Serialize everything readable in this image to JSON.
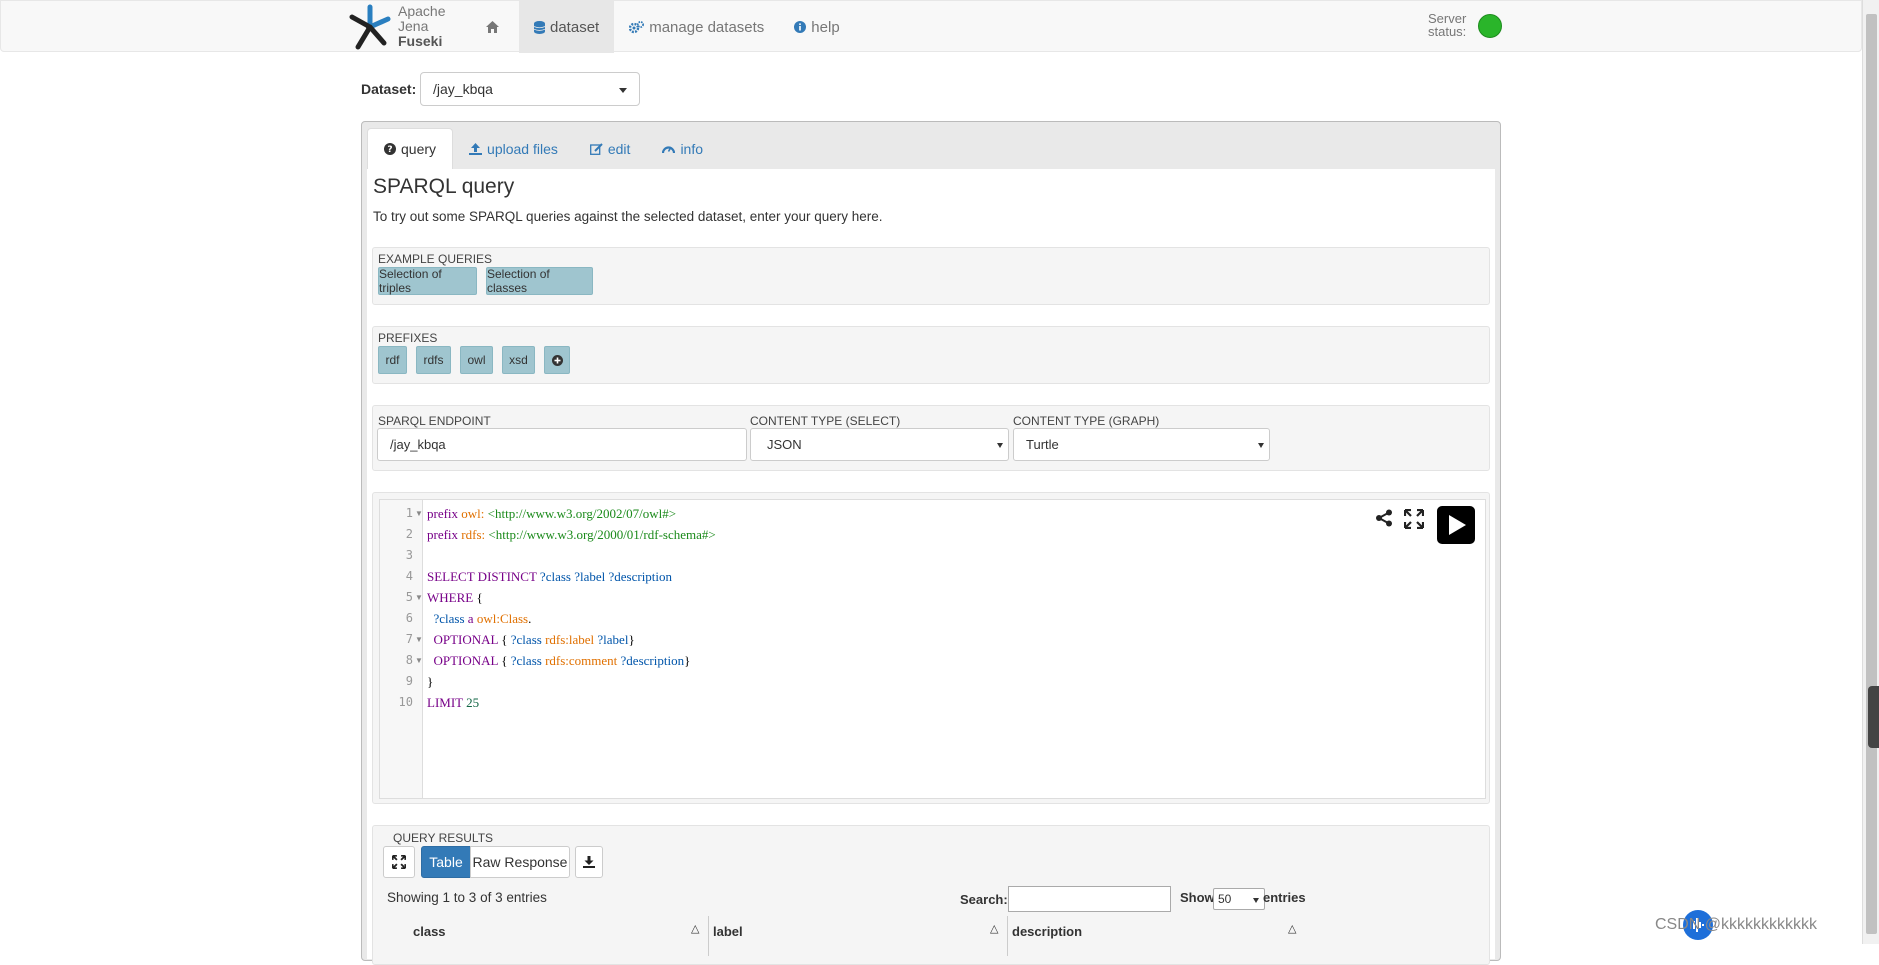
{
  "brand": {
    "line1": "Apache",
    "line2": "Jena",
    "line3": "Fuseki"
  },
  "nav": {
    "home_icon": "home-icon",
    "dataset": "dataset",
    "manage": "manage datasets",
    "help": "help"
  },
  "server_status": {
    "label_line1": "Server",
    "label_line2": "status:",
    "color": "#2ab52a"
  },
  "dataset_selector": {
    "label": "Dataset:",
    "value": "/jay_kbqa"
  },
  "tabs": {
    "query": "query",
    "upload": "upload files",
    "edit": "edit",
    "info": "info"
  },
  "query_page": {
    "title": "SPARQL query",
    "description": "To try out some SPARQL queries against the selected dataset, enter your query here."
  },
  "examples": {
    "label": "EXAMPLE QUERIES",
    "items": [
      "Selection of triples",
      "Selection of classes"
    ]
  },
  "prefixes": {
    "label": "PREFIXES",
    "items": [
      "rdf",
      "rdfs",
      "owl",
      "xsd"
    ]
  },
  "endpoint": {
    "endpoint_label": "SPARQL ENDPOINT",
    "endpoint_value": "/jay_kbqa",
    "select_label": "CONTENT TYPE (SELECT)",
    "select_value": "JSON",
    "graph_label": "CONTENT TYPE (GRAPH)",
    "graph_value": "Turtle"
  },
  "editor": {
    "line_numbers": [
      "1",
      "2",
      "3",
      "4",
      "5",
      "6",
      "7",
      "8",
      "9",
      "10"
    ],
    "lines": {
      "l1": {
        "kw": "prefix",
        "pfx": "owl:",
        "uri": "<http://www.w3.org/2002/07/owl#>"
      },
      "l2": {
        "kw": "prefix",
        "pfx": "rdfs:",
        "uri": "<http://www.w3.org/2000/01/rdf-schema#>"
      },
      "l4": {
        "kw": "SELECT DISTINCT",
        "vars": "?class ?label ?description"
      },
      "l5": {
        "kw": "WHERE",
        "brace": "{"
      },
      "l6": {
        "var": "?class",
        "a": "a",
        "pfx": "owl:Class",
        "end": "."
      },
      "l7": {
        "kw": "OPTIONAL",
        "open": "{",
        "var1": "?class",
        "pfx": "rdfs:label",
        "var2": "?label",
        "close": "}"
      },
      "l8": {
        "kw": "OPTIONAL",
        "open": "{",
        "var1": "?class",
        "pfx": "rdfs:comment",
        "var2": "?description",
        "close": "}"
      },
      "l9": {
        "brace": "}"
      },
      "l10": {
        "kw": "LIMIT",
        "num": "25"
      }
    }
  },
  "results": {
    "label": "QUERY RESULTS",
    "table_btn": "Table",
    "raw_btn": "Raw Response",
    "showing": "Showing 1 to 3 of 3 entries",
    "search_label": "Search:",
    "show_label": "Show",
    "show_value": "50",
    "entries_label": "entries",
    "columns": [
      "class",
      "label",
      "description"
    ]
  },
  "watermark": "CSDN @kkkkkkkkkkkk"
}
